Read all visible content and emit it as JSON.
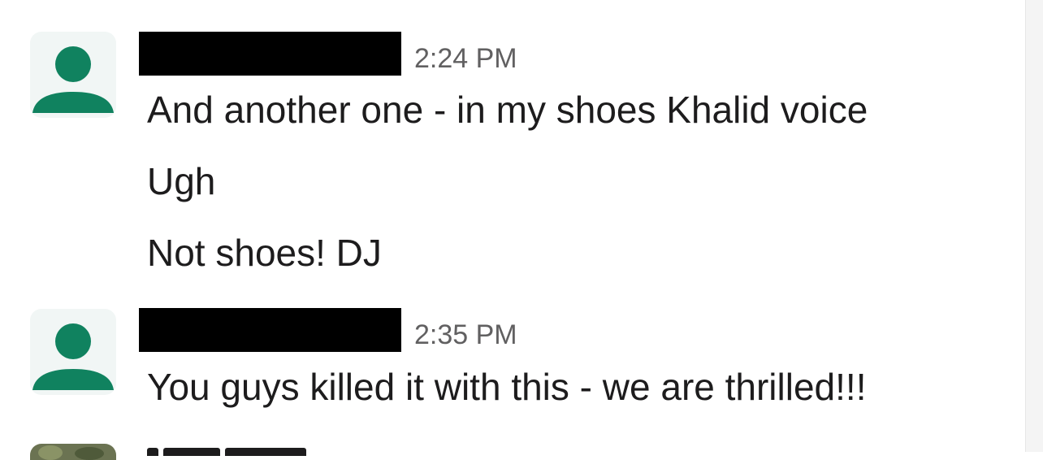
{
  "messages": [
    {
      "author_redacted": true,
      "timestamp": "2:24 PM",
      "lines": [
        "And another one - in my shoes Khalid voice",
        "Ugh",
        "Not shoes! DJ"
      ]
    },
    {
      "author_redacted": true,
      "timestamp": "2:35 PM",
      "lines": [
        "You guys killed it with this - we are thrilled!!!"
      ]
    }
  ],
  "colors": {
    "avatar_figure": "#10825f",
    "avatar_bg": "#f1f6f5",
    "timestamp": "#616061",
    "text": "#1d1c1d",
    "redaction": "#000000"
  },
  "icons": {
    "default_avatar": "person-silhouette-icon"
  }
}
